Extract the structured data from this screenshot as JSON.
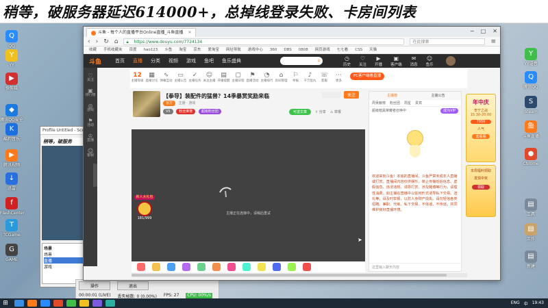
{
  "banner": {
    "text": "稍等，破服务器延迟614000+，总掉线登录失败、卡房间列表"
  },
  "desktop_left": [
    {
      "label": "QQ",
      "color": "#2a8bff",
      "glyph": "Q"
    },
    {
      "label": "YY",
      "color": "#f0c020",
      "glyph": "Y"
    },
    {
      "label": "快剪辑",
      "color": "#d03030",
      "glyph": "▶"
    },
    {
      "label": "腾讯QQ安全中心",
      "color": "#1a7ae0",
      "glyph": "◆"
    },
    {
      "label": "酷狗音乐",
      "color": "#1b6fe0",
      "glyph": "K"
    },
    {
      "label": "腾讯视频",
      "color": "#ff7a1a",
      "glyph": "▶"
    },
    {
      "label": "迅雷",
      "color": "#2a6fe0",
      "glyph": "↓"
    },
    {
      "label": "FlashCenter",
      "color": "#d02020",
      "glyph": "f"
    },
    {
      "label": "TCGame",
      "color": "#2a9adf",
      "glyph": "T"
    },
    {
      "label": "GAME",
      "color": "#444444",
      "glyph": "G"
    }
  ],
  "desktop_right": [
    {
      "label": "YY语音",
      "color": "#3fbf4a",
      "glyph": "Y"
    },
    {
      "label": "腾讯QQ",
      "color": "#2a8bff",
      "glyph": "Q"
    },
    {
      "label": "Steam",
      "color": "#2b4a6e",
      "glyph": "S"
    },
    {
      "label": "斗鱼直播",
      "color": "#ff7a1a",
      "glyph": "鱼"
    },
    {
      "label": "Chrome",
      "color": "#e04a2a",
      "glyph": "●"
    },
    {
      "label": "工具",
      "color": "#7a8a9a",
      "glyph": "▤"
    },
    {
      "label": "工作",
      "color": "#c9a46a",
      "glyph": "▤"
    },
    {
      "label": "新建",
      "color": "#7a8a9a",
      "glyph": "▤"
    }
  ],
  "bg_window": {
    "title": "Profile Untitled - Scenes Untitled",
    "mini_banner": "稍等，破服务",
    "list_title": "场景",
    "list_items": [
      "场景",
      "直播",
      "游戏"
    ]
  },
  "obs_status": {
    "btn1": "操作",
    "btn2": "退出",
    "stats": [
      "00:00:01 (LIVE)",
      "丢失帧数: 0 (0.00%)",
      "FPS: 27",
      "CPU: 00%/s"
    ]
  },
  "browser": {
    "tab_title": "斗鱼 - 每个人的直播平台Online直播_斗鱼直播",
    "url": "https://www.douyu.com/7724134",
    "search_placeholder": "在此搜索",
    "win_controls": [
      "─",
      "□",
      "✕"
    ],
    "bookmarks": [
      "收藏",
      "手机收藏夹",
      "百度",
      "hao123",
      "斗鱼",
      "淘宝",
      "京东",
      "爱淘宝",
      "网址导航",
      "游戏中心",
      "360",
      "DBS",
      "0808",
      "网页游戏",
      "七七看",
      "CSS",
      "天猫"
    ]
  },
  "douyu_header": {
    "logo": "斗鱼",
    "nav": [
      "首页",
      "直播",
      "分类",
      "视频",
      "游戏",
      "鱼吧",
      "鱼乐盛典"
    ],
    "right_items": [
      "历史",
      "关注",
      "开播",
      "客户端",
      "消息",
      "鱼乐"
    ]
  },
  "left_sidebar": [
    {
      "glyph": "♡",
      "label": "关注"
    },
    {
      "glyph": "▣",
      "label": "排行榜"
    },
    {
      "glyph": "◎",
      "label": "游戏"
    },
    {
      "glyph": "⚑",
      "label": "活动"
    },
    {
      "glyph": "♔",
      "label": "直播"
    },
    {
      "glyph": "☺",
      "label": "客服"
    }
  ],
  "category_bar": {
    "level": "12",
    "level_label": "主播等级",
    "items": [
      {
        "glyph": "▦",
        "label": "直播讨论"
      },
      {
        "glyph": "∿",
        "label": "弹幕互动"
      },
      {
        "glyph": "▭",
        "label": "主播公告"
      },
      {
        "glyph": "✓",
        "label": "主播任务"
      },
      {
        "glyph": "☺",
        "label": "关注主播"
      },
      {
        "glyph": "▤",
        "label": "开播提醒"
      },
      {
        "glyph": "▢",
        "label": "主播日程"
      },
      {
        "glyph": "⚑",
        "label": "直播活动"
      },
      {
        "glyph": "◔",
        "label": "主播排行"
      },
      {
        "glyph": "⌂",
        "label": "房间管理"
      },
      {
        "glyph": "⚐",
        "label": "举报"
      },
      {
        "glyph": "♪",
        "label": "千万鱼丸"
      },
      {
        "glyph": "☏",
        "label": "客服"
      },
      {
        "glyph": "⋯",
        "label": "更多"
      }
    ],
    "pc_button": "PC客户端看直播"
  },
  "room": {
    "title": "【拳导】装配件的猛兽？14季暴赏奖励来临",
    "meta": "主播 · 游戏",
    "tags": [
      {
        "text": "官方",
        "color": "#ff7a1a"
      },
      {
        "text": "关注 0",
        "color": "#cfcfcf"
      }
    ],
    "badges": [
      {
        "text": "V5",
        "color": "#7a7a7a"
      },
      {
        "text": "粉丝荣誉",
        "color": "#e0302a"
      },
      {
        "text": "超级粉丝团",
        "color": "#9a4adf"
      }
    ],
    "follow": "关注",
    "send_gift": "可送文章",
    "share": "分享",
    "report": "举报"
  },
  "player": {
    "message": "主播正在连接中，请稍后重试",
    "gift_badge_top": "新人大礼包",
    "gift_badge_count": "181/999"
  },
  "gifts": [
    {
      "color": "#ff6b6b"
    },
    {
      "color": "#f2c14e"
    },
    {
      "color": "#4ea1f2"
    },
    {
      "color": "#b46bf2"
    },
    {
      "color": "#6bd18f"
    },
    {
      "color": "#f28f4e"
    },
    {
      "color": "#f24e8f"
    },
    {
      "color": "#4ef2d3"
    },
    {
      "color": "#f2e44e"
    },
    {
      "color": "#4e6bf2"
    },
    {
      "color": "#9af24e"
    },
    {
      "color": "#f24e4e"
    }
  ],
  "chat": {
    "tabs": [
      "主播榜",
      "主播公告"
    ],
    "sub": [
      "周贡献榜",
      "粉丝团",
      "周星",
      "贵宾"
    ],
    "rank_text": "超级暗黑荣耀者召唤中",
    "join": "成为VIP",
    "notice": "欢迎来到斗鱼！本房的直播间，斗鱼严禁未成年人直播或打赏。直播间内容仅供娱乐，禁止传播低俗信息、虚假信息、违法违规、诱导打赏、涉及赌博等行为，请理性消费。如主播在直播中以任何形式诱导私下交易、送礼等，请及时举报，以防人身财产损失。请勿轻信各类招聘、兼职、代练、私下交易，不信谣、不传谣，共同维护良好直播环境。",
    "input_placeholder": "这里输入聊天内容"
  },
  "ad": {
    "title": "年中庆",
    "sub": "李宁之战",
    "line1": "15:30-20:00",
    "price": "7959",
    "tag": "人气",
    "cta": "去看看",
    "box2_title": "本周福利领取",
    "box2_line": "发现中奖",
    "box2_cta": "领取"
  },
  "taskbar": {
    "start": "⊞",
    "items": [
      "#3a8ee6",
      "#ff7a1a",
      "#2a8bff",
      "#e04a2a",
      "#3fbf4a",
      "#f0c020",
      "#7a5ae0",
      "#2ab0a0"
    ],
    "tray": [
      "ENG",
      "中",
      "19:43"
    ]
  }
}
